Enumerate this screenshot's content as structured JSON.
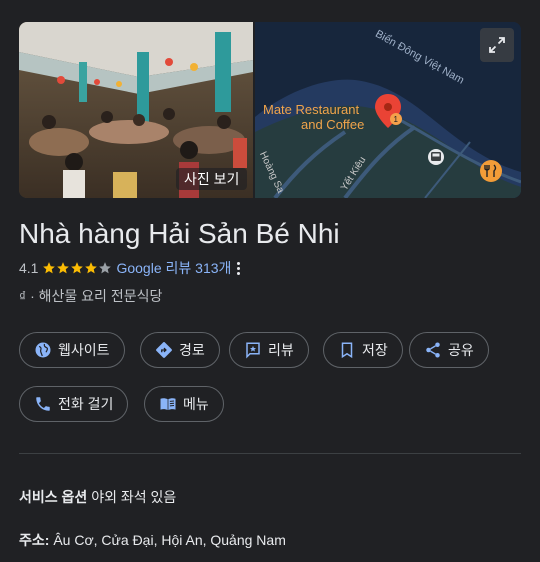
{
  "photo": {
    "label": "사진 보기"
  },
  "map": {
    "poi_name_line1": "Mate Restaurant",
    "poi_name_line2": "and Coffee",
    "sea_label": "Biển Đông Việt Nam",
    "street1": "Hoàng Sa",
    "street2": "Yết Kiêu"
  },
  "place": {
    "name": "Nhà hàng Hải Sản Bé Nhi",
    "rating": "4.1",
    "rating_value": 4.1,
    "reviews_link": "Google 리뷰 313개",
    "price": "₫",
    "separator": "·",
    "category": "해산물 요리 전문식당"
  },
  "actions": {
    "website": "웹사이트",
    "directions": "경로",
    "review": "리뷰",
    "save": "저장",
    "share": "공유",
    "call": "전화 걸기",
    "menu": "메뉴"
  },
  "details": {
    "service_label": "서비스 옵션",
    "service_value": "야외 좌석 있음",
    "address_label": "주소:",
    "address_value": "Âu Cơ, Cửa Đại, Hội An, Quảng Nam"
  },
  "colors": {
    "background": "#202124",
    "link": "#8ab4f8",
    "star": "#fbbc04",
    "map_water": "#17263c",
    "pin": "#ea4335"
  }
}
